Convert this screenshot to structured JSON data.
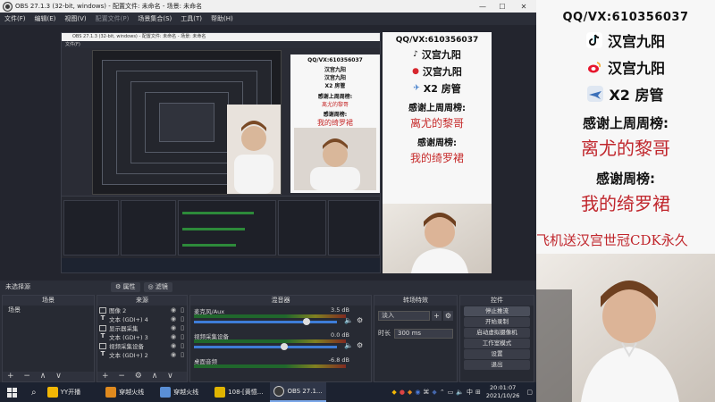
{
  "window": {
    "title": "OBS 27.1.3 (32-bit, windows) - 配置文件: 未命名 - 场景: 未命名",
    "controls": [
      "—",
      "☐",
      "✕"
    ]
  },
  "menu": [
    "文件(F)",
    "编辑(E)",
    "视图(V)",
    "配置文件(P)",
    "场景集合(S)",
    "工具(T)",
    "帮助(H)"
  ],
  "nested_title": "OBS 27.1.3 (32-bit, windows) - 配置文件: 未命名 - 场景: 未命名",
  "overlay": {
    "qq": "QQ/VX:610356037",
    "rows": [
      {
        "icon": "tiktok-icon",
        "label": "汉宫九阳"
      },
      {
        "icon": "weibo-icon",
        "label": "汉宫九阳"
      },
      {
        "icon": "x2-icon",
        "label": "X2 房管"
      }
    ],
    "last_week_heading": "感谢上周周榜:",
    "last_week_name": "离尤的黎哥",
    "week_heading": "感谢周榜:",
    "week_name": "我的绮罗裙",
    "scroll": "飞机送汉宫世冠CDK永久"
  },
  "scene_bar": {
    "label": "未选择源",
    "properties_btn": "属性",
    "filters_btn": "滤镜"
  },
  "docks": {
    "scenes": {
      "title": "场景",
      "items": [
        "场景"
      ],
      "footer": "+ − ∧ ∨"
    },
    "sources": {
      "title": "来源",
      "items": [
        {
          "type": "image",
          "label": "图像 2"
        },
        {
          "type": "text",
          "label": "文本 (GDI+) 4"
        },
        {
          "type": "display",
          "label": "显示器采集"
        },
        {
          "type": "text",
          "label": "文本 (GDI+) 3"
        },
        {
          "type": "video",
          "label": "视频采集设备"
        },
        {
          "type": "text",
          "label": "文本 (GDI+) 2"
        }
      ],
      "footer": "+ − ⚙ ∧ ∨"
    },
    "mixer": {
      "title": "混音器",
      "items": [
        {
          "name": "麦克风/Aux",
          "db": "3.5 dB",
          "level": 0.78
        },
        {
          "name": "视频采集设备",
          "db": "0.0 dB",
          "level": 0.62
        },
        {
          "name": "桌面音频",
          "db": "-6.8 dB",
          "level": 0.45
        }
      ]
    },
    "transitions": {
      "title": "转场特效",
      "selected": "淡入",
      "duration_label": "时长",
      "duration": "300 ms"
    },
    "controls": {
      "title": "控件",
      "buttons": [
        "停止推流",
        "开始录制",
        "启动虚拟摄像机",
        "工作室模式",
        "设置",
        "退出"
      ]
    }
  },
  "taskbar": {
    "apps": [
      {
        "label": "YY开播",
        "color": "#f2b705"
      },
      {
        "label": "穿越火线",
        "color": "#e08a1e"
      },
      {
        "label": "穿越火线",
        "color": "#5a8fd6"
      },
      {
        "label": "108-[黄憶...",
        "color": "#e0b400"
      },
      {
        "label": "OBS 27.1...",
        "color": "#3a3a3a"
      }
    ],
    "ime": "中",
    "time": "20:01:07",
    "date": "2021/10/26"
  },
  "right_panel": {
    "qq": "QQ/VX:610356037",
    "rows": [
      {
        "icon": "tiktok-icon",
        "label": "汉宫九阳"
      },
      {
        "icon": "weibo-icon",
        "label": "汉宫九阳"
      },
      {
        "icon": "x2-icon",
        "label": "X2 房管"
      }
    ],
    "last_week_heading": "感谢上周周榜:",
    "last_week_name": "离尤的黎哥",
    "week_heading": "感谢周榜:",
    "week_name": "我的绮罗裙",
    "scroll": "飞机送汉宫世冠CDK永久"
  }
}
